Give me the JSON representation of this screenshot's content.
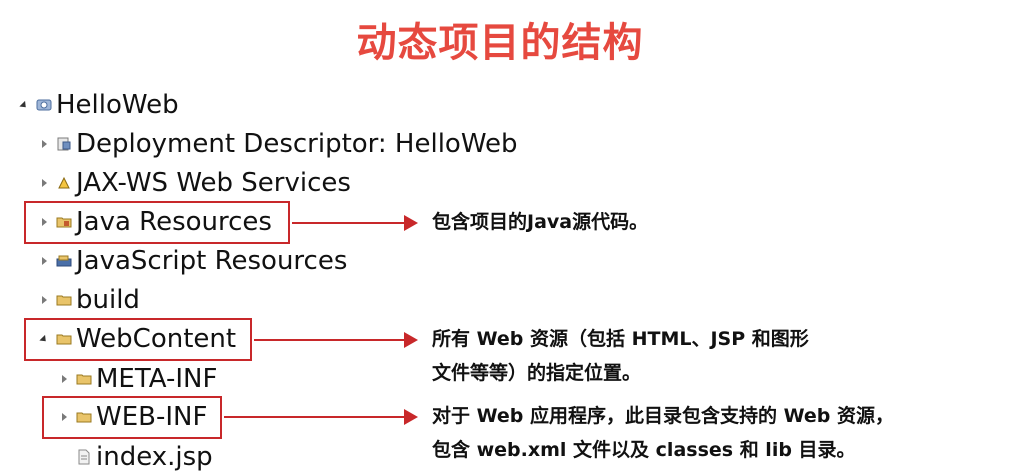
{
  "title": "动态项目的结构",
  "tree": {
    "root": "HelloWeb",
    "deployment_descriptor": "Deployment Descriptor: HelloWeb",
    "jax_ws": "JAX-WS Web Services",
    "java_resources": "Java Resources",
    "javascript_resources": "JavaScript Resources",
    "build": "build",
    "webcontent": "WebContent",
    "meta_inf": "META-INF",
    "web_inf": "WEB-INF",
    "index_jsp": "index.jsp"
  },
  "annotations": {
    "java_resources": "包含项目的Java源代码。",
    "webcontent_line1": "所有 Web 资源（包括 HTML、JSP 和图形",
    "webcontent_line2": "文件等等）的指定位置。",
    "web_inf_line1": "对于 Web 应用程序，此目录包含支持的 Web 资源，",
    "web_inf_line2": "包含 web.xml 文件以及 classes 和 lib 目录。"
  },
  "colors": {
    "title": "#e6493f",
    "highlight": "#c8282a",
    "text": "#111111"
  },
  "icons": {
    "root": "web-project-icon",
    "deployment_descriptor": "deployment-descriptor-icon",
    "jax_ws": "web-services-icon",
    "java_resources": "java-resources-folder-icon",
    "javascript_resources": "javascript-resources-icon",
    "folder": "folder-icon",
    "file": "jsp-file-icon"
  }
}
